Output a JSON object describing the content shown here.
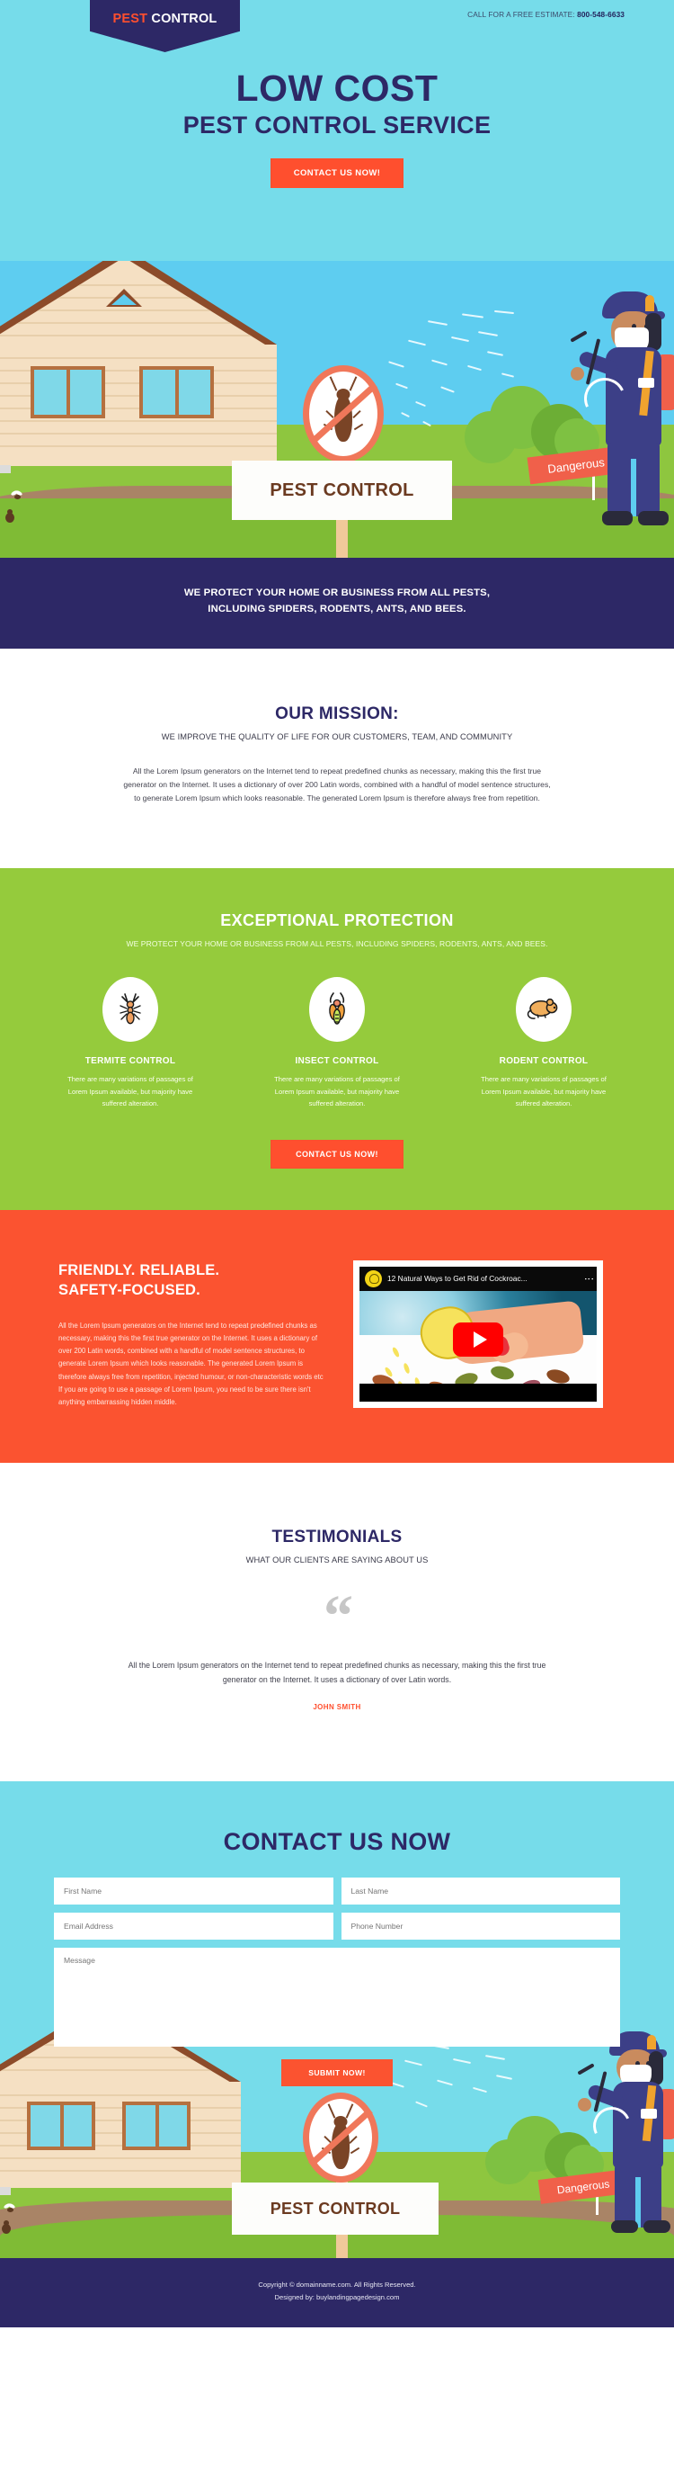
{
  "header": {
    "logo_pest": "PEST",
    "logo_control": " CONTROL",
    "call_prefix": "CALL FOR A FREE ESTIMATE: ",
    "phone": "800-548-6633"
  },
  "hero": {
    "title_line1": "LOW COST",
    "title_line2": "PEST CONTROL SERVICE",
    "cta_label": "CONTACT US NOW!",
    "sign_label": "PEST CONTROL",
    "danger_label": "Dangerous"
  },
  "navy_banner": {
    "line1": "WE PROTECT YOUR HOME OR BUSINESS FROM ALL PESTS,",
    "line2": "INCLUDING SPIDERS, RODENTS, ANTS, AND BEES."
  },
  "mission": {
    "heading": "OUR MISSION:",
    "subheading": "WE IMPROVE THE QUALITY OF LIFE FOR OUR CUSTOMERS, TEAM, AND COMMUNITY",
    "body": "All the Lorem Ipsum generators on the Internet tend to repeat predefined chunks as necessary, making this the first true generator on the Internet. It uses a dictionary of over 200 Latin words, combined with a handful of model sentence structures, to generate Lorem Ipsum which looks reasonable. The generated Lorem Ipsum is therefore always free from repetition."
  },
  "protection": {
    "heading": "EXCEPTIONAL PROTECTION",
    "subheading": "WE PROTECT YOUR HOME OR BUSINESS FROM ALL PESTS, INCLUDING SPIDERS, RODENTS, ANTS, AND BEES.",
    "cards": [
      {
        "icon": "ant-icon",
        "title": "TERMITE CONTROL",
        "text": "There are many variations of passages of Lorem Ipsum available, but majority have suffered alteration."
      },
      {
        "icon": "insect-icon",
        "title": "INSECT CONTROL",
        "text": "There are many variations of passages of Lorem Ipsum available, but majority have suffered alteration."
      },
      {
        "icon": "mouse-icon",
        "title": "RODENT CONTROL",
        "text": "There are many variations of passages of Lorem Ipsum available, but majority have suffered alteration."
      }
    ],
    "cta_label": "CONTACT US NOW!"
  },
  "features": {
    "heading_line1": "FRIENDLY. RELIABLE.",
    "heading_line2": "SAFETY-FOCUSED.",
    "body": "All the Lorem Ipsum generators on the Internet tend to repeat predefined chunks as necessary, making this the first true generator on the Internet. It uses a dictionary of over 200 Latin words, combined with a handful of model sentence structures, to generate Lorem Ipsum which looks reasonable. The generated Lorem Ipsum is therefore always free from repetition, injected humour, or non-characteristic words etc If you are going to use a passage of Lorem Ipsum, you need to be sure there isn't anything embarrassing hidden middle.",
    "video_title": "12 Natural Ways to Get Rid of Cockroac..."
  },
  "testimonials": {
    "heading": "TESTIMONIALS",
    "subheading": "WHAT OUR CLIENTS ARE SAYING ABOUT US",
    "quote_glyph": "“",
    "quote": "All the Lorem Ipsum generators on the Internet tend to repeat predefined chunks as necessary, making this the first true generator on the Internet. It uses a dictionary of over Latin words.",
    "author": "JOHN SMITH"
  },
  "contact": {
    "heading": "CONTACT US NOW",
    "first_name_placeholder": "First Name",
    "last_name_placeholder": "Last Name",
    "email_placeholder": "Email Address",
    "phone_placeholder": "Phone Number",
    "message_placeholder": "Message",
    "submit_label": "SUBMIT NOW!",
    "sign_label": "PEST CONTROL",
    "danger_label": "Dangerous"
  },
  "footer": {
    "copyright": "Copyright © domainname.com. All Rights Reserved.",
    "designed_by": "Designed by: buylandingpagedesign.com"
  },
  "colors": {
    "sky": "#76dcea",
    "navy": "#2d2866",
    "orange": "#fb5330",
    "cta_orange": "#ff4f2e",
    "green": "#95cb3c",
    "grass": "#8ec63f"
  }
}
